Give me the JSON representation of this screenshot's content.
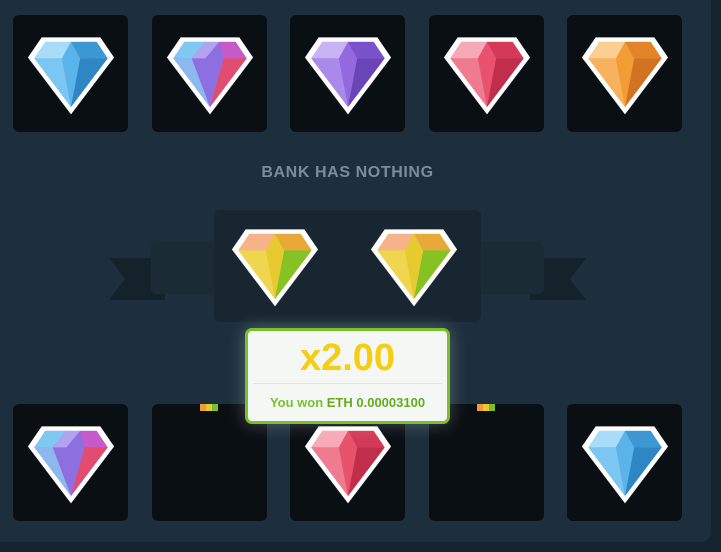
{
  "top_row": [
    {
      "gem": "blue-diamond"
    },
    {
      "gem": "rainbow-diamond"
    },
    {
      "gem": "purple-diamond"
    },
    {
      "gem": "red-diamond"
    },
    {
      "gem": "orange-diamond"
    }
  ],
  "bank": {
    "label": "BANK HAS NOTHING",
    "gems": [
      "yellow-diamond",
      "yellow-diamond"
    ]
  },
  "win": {
    "multiplier": "x2.00",
    "prefix": "You won",
    "amount": "ETH 0.00003100"
  },
  "bottom_row": [
    {
      "gem": "rainbow-diamond"
    },
    {
      "gem": "empty"
    },
    {
      "gem": "red-diamond"
    },
    {
      "gem": "empty"
    },
    {
      "gem": "blue-diamond"
    }
  ],
  "colors": {
    "blue": "#64b8ec",
    "purple": "#9a6ee3",
    "red": "#e8526d",
    "orange": "#f29c35",
    "yellow": "#e9c92e",
    "accent_green": "#7ac02d",
    "multiplier_yellow": "#f5cd11"
  }
}
